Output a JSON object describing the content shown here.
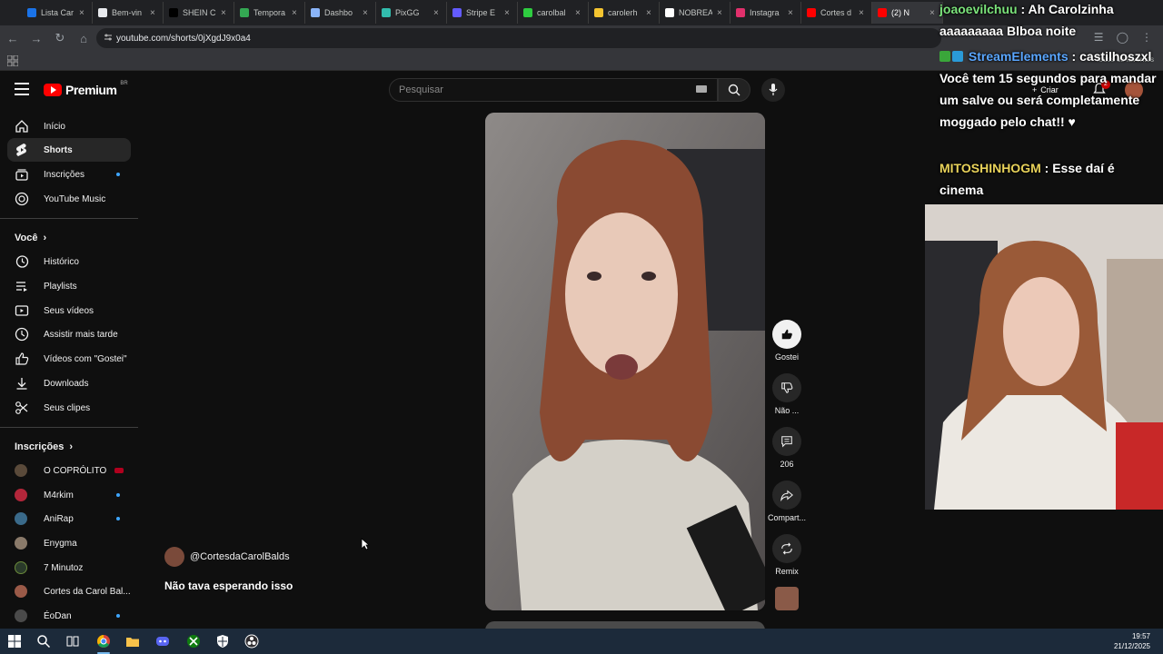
{
  "browser": {
    "tabs": [
      {
        "label": "Lista Car",
        "favicon_color": "#1a73e8"
      },
      {
        "label": "Bem-vin",
        "favicon_color": "#e8eaed"
      },
      {
        "label": "SHEIN C",
        "favicon_color": "#000000"
      },
      {
        "label": "Tempora",
        "favicon_color": "#34a853"
      },
      {
        "label": "Dashbo",
        "favicon_color": "#8ab4f8"
      },
      {
        "label": "PixGG",
        "favicon_color": "#32bcad"
      },
      {
        "label": "Stripe E",
        "favicon_color": "#635bff"
      },
      {
        "label": "carolbal",
        "favicon_color": "#2ecc40"
      },
      {
        "label": "carolerh",
        "favicon_color": "#f4c430"
      },
      {
        "label": "NOBREA",
        "favicon_color": "#ffffff"
      },
      {
        "label": "Instagra",
        "favicon_color": "#e1306c"
      },
      {
        "label": "Cortes d",
        "favicon_color": "#ff0000"
      },
      {
        "label": "(2) N",
        "favicon_color": "#ff0000"
      }
    ],
    "url": "youtube.com/shorts/0jXgdJ9x0a4",
    "bookmarks_all": "Todos os favoritos"
  },
  "youtube": {
    "logo_text": "Premium",
    "region": "BR",
    "search_placeholder": "Pesquisar",
    "create_label": "Criar",
    "notification_count": "2",
    "sidebar": {
      "main": [
        {
          "label": "Início",
          "icon": "home-icon"
        },
        {
          "label": "Shorts",
          "icon": "shorts-icon"
        },
        {
          "label": "Inscrições",
          "icon": "subscriptions-icon"
        },
        {
          "label": "YouTube Music",
          "icon": "music-icon"
        }
      ],
      "you_header": "Você",
      "you": [
        {
          "label": "Histórico",
          "icon": "history-icon"
        },
        {
          "label": "Playlists",
          "icon": "playlists-icon"
        },
        {
          "label": "Seus vídeos",
          "icon": "your-videos-icon"
        },
        {
          "label": "Assistir mais tarde",
          "icon": "watch-later-icon"
        },
        {
          "label": "Vídeos com \"Gostei\"",
          "icon": "liked-icon"
        },
        {
          "label": "Downloads",
          "icon": "download-icon"
        },
        {
          "label": "Seus clipes",
          "icon": "clips-icon"
        }
      ],
      "subs_header": "Inscrições",
      "subscriptions": [
        {
          "label": "O COPRÓLITO"
        },
        {
          "label": "M4rkim"
        },
        {
          "label": "AniRap"
        },
        {
          "label": "Enygma"
        },
        {
          "label": "7 Minutoz"
        },
        {
          "label": "Cortes da Carol Bal..."
        },
        {
          "label": "ÉoDan"
        }
      ]
    },
    "short": {
      "channel": "@CortesdaCarolBalds",
      "title": "Não tava esperando isso",
      "actions": {
        "like": "Gostei",
        "dislike": "Não ...",
        "comments": "206",
        "share": "Compart...",
        "remix": "Remix"
      }
    }
  },
  "stream_chat": [
    {
      "user": "joaoevilchuu",
      "text": "Ah Carolzinha aaaaaaaaa Blboa noite"
    },
    {
      "user": "StreamElements",
      "text": "castilhoszxl Você tem 15 segundos para mandar um salve ou será completamente moggado pelo chat!! ♥"
    },
    {
      "user": "MITOSHINHOGM",
      "text": "Esse daí é cinema"
    }
  ],
  "taskbar": {
    "time": "19:57",
    "date": "21/12/2025"
  }
}
